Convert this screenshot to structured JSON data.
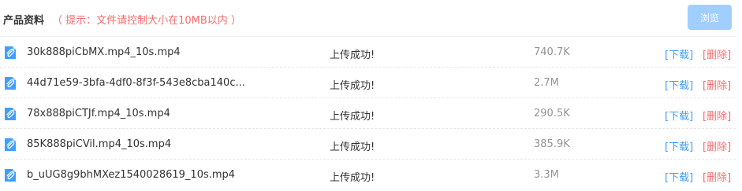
{
  "header": {
    "title": "产品资料",
    "hint": "（ 提示：文件请控制大小在10MB以内 ）",
    "browse_label": "浏览"
  },
  "colors": {
    "accent": "#409eff",
    "danger": "#f56c6c",
    "browse_button": "#a0cfff"
  },
  "files": [
    {
      "name": "30k888piCbMX.mp4_10s.mp4",
      "status": "上传成功!",
      "size": "740.7K",
      "download_label": "[下载]",
      "delete_label": "[删除]",
      "icon": "attachment-icon"
    },
    {
      "name": "44d71e59-3bfa-4df0-8f3f-543e8cba140c...",
      "status": "上传成功!",
      "size": "2.7M",
      "download_label": "[下载]",
      "delete_label": "[删除]",
      "icon": "attachment-icon"
    },
    {
      "name": "78x888piCTJf.mp4_10s.mp4",
      "status": "上传成功!",
      "size": "290.5K",
      "download_label": "[下载]",
      "delete_label": "[删除]",
      "icon": "attachment-icon"
    },
    {
      "name": "85K888piCVil.mp4_10s.mp4",
      "status": "上传成功!",
      "size": "385.9K",
      "download_label": "[下载]",
      "delete_label": "[删除]",
      "icon": "attachment-icon"
    },
    {
      "name": "b_uUG8g9bhMXez1540028619_10s.mp4",
      "status": "上传成功!",
      "size": "3.3M",
      "download_label": "[下载]",
      "delete_label": "[删除]",
      "icon": "attachment-icon"
    }
  ]
}
